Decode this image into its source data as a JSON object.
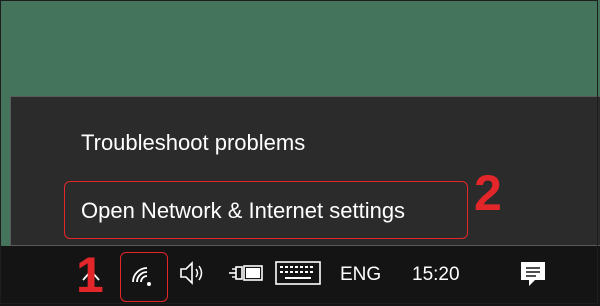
{
  "menu": {
    "items": [
      {
        "label": "Troubleshoot problems"
      },
      {
        "label": "Open Network & Internet settings"
      }
    ]
  },
  "taskbar": {
    "language": "ENG",
    "time": "15:20",
    "icons": [
      "chevron-up-icon",
      "wifi-icon",
      "volume-icon",
      "power-icon",
      "keyboard-icon",
      "notification-icon"
    ]
  },
  "annotations": {
    "step1": "1",
    "step2": "2",
    "color": "#e3262a"
  },
  "colors": {
    "desktop": "#44745c",
    "menu_bg": "#2b2b2b",
    "taskbar_bg": "#141414"
  }
}
